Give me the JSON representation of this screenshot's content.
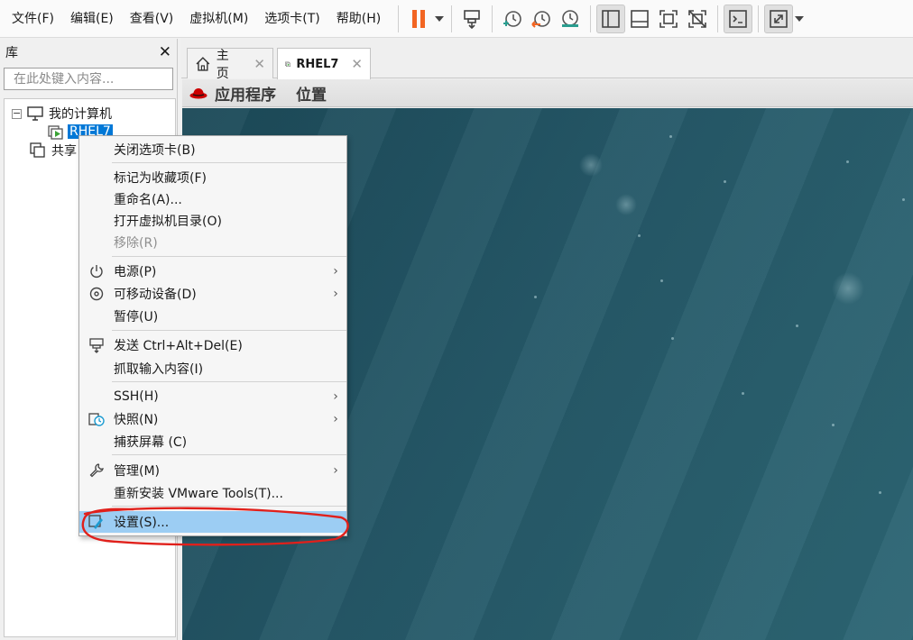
{
  "menubar": {
    "items": [
      "文件(F)",
      "编辑(E)",
      "查看(V)",
      "虚拟机(M)",
      "选项卡(T)",
      "帮助(H)"
    ]
  },
  "toolbar": {
    "buttons": [
      "pause-icon",
      "send-ctrl-alt-del-icon",
      "snapshot-icon",
      "revert-snapshot-icon",
      "snapshot-manager-icon",
      "show-library-icon",
      "thumbnail-bar-icon",
      "full-screen-icon",
      "unity-icon",
      "console-view-icon",
      "stretch-guest-icon"
    ],
    "accent": "#f26522"
  },
  "library": {
    "title": "库",
    "search_placeholder": "在此处键入内容...",
    "tree": {
      "root": "我的计算机",
      "vm": "RHEL7",
      "shared": "共享"
    }
  },
  "tabs": [
    {
      "label": "主页",
      "icon": "home-icon"
    },
    {
      "label": "RHEL7",
      "icon": "vm-running-icon"
    }
  ],
  "guest": {
    "menu_apps": "应用程序",
    "menu_places": "位置",
    "bg_color": "#255868"
  },
  "context_menu": {
    "groups": [
      [
        {
          "label": "关闭选项卡(B)"
        }
      ],
      [
        {
          "label": "标记为收藏项(F)"
        },
        {
          "label": "重命名(A)..."
        },
        {
          "label": "打开虚拟机目录(O)"
        },
        {
          "label": "移除(R)",
          "disabled": true
        }
      ],
      [
        {
          "label": "电源(P)",
          "icon": "power-icon",
          "submenu": true
        },
        {
          "label": "可移动设备(D)",
          "icon": "removable-device-icon",
          "submenu": true
        },
        {
          "label": "暂停(U)"
        }
      ],
      [
        {
          "label": "发送 Ctrl+Alt+Del(E)",
          "icon": "send-keys-icon"
        },
        {
          "label": "抓取输入内容(I)"
        }
      ],
      [
        {
          "label": "SSH(H)",
          "submenu": true
        },
        {
          "label": "快照(N)",
          "icon": "snapshot-icon",
          "submenu": true
        },
        {
          "label": "捕获屏幕 (C)"
        }
      ],
      [
        {
          "label": "管理(M)",
          "icon": "wrench-icon",
          "submenu": true
        },
        {
          "label": "重新安装 VMware Tools(T)..."
        }
      ],
      [
        {
          "label": "设置(S)...",
          "icon": "settings-icon",
          "highlighted": true
        }
      ]
    ],
    "highlight_color": "#9ccdf3",
    "annotation_color": "#e0201b"
  }
}
